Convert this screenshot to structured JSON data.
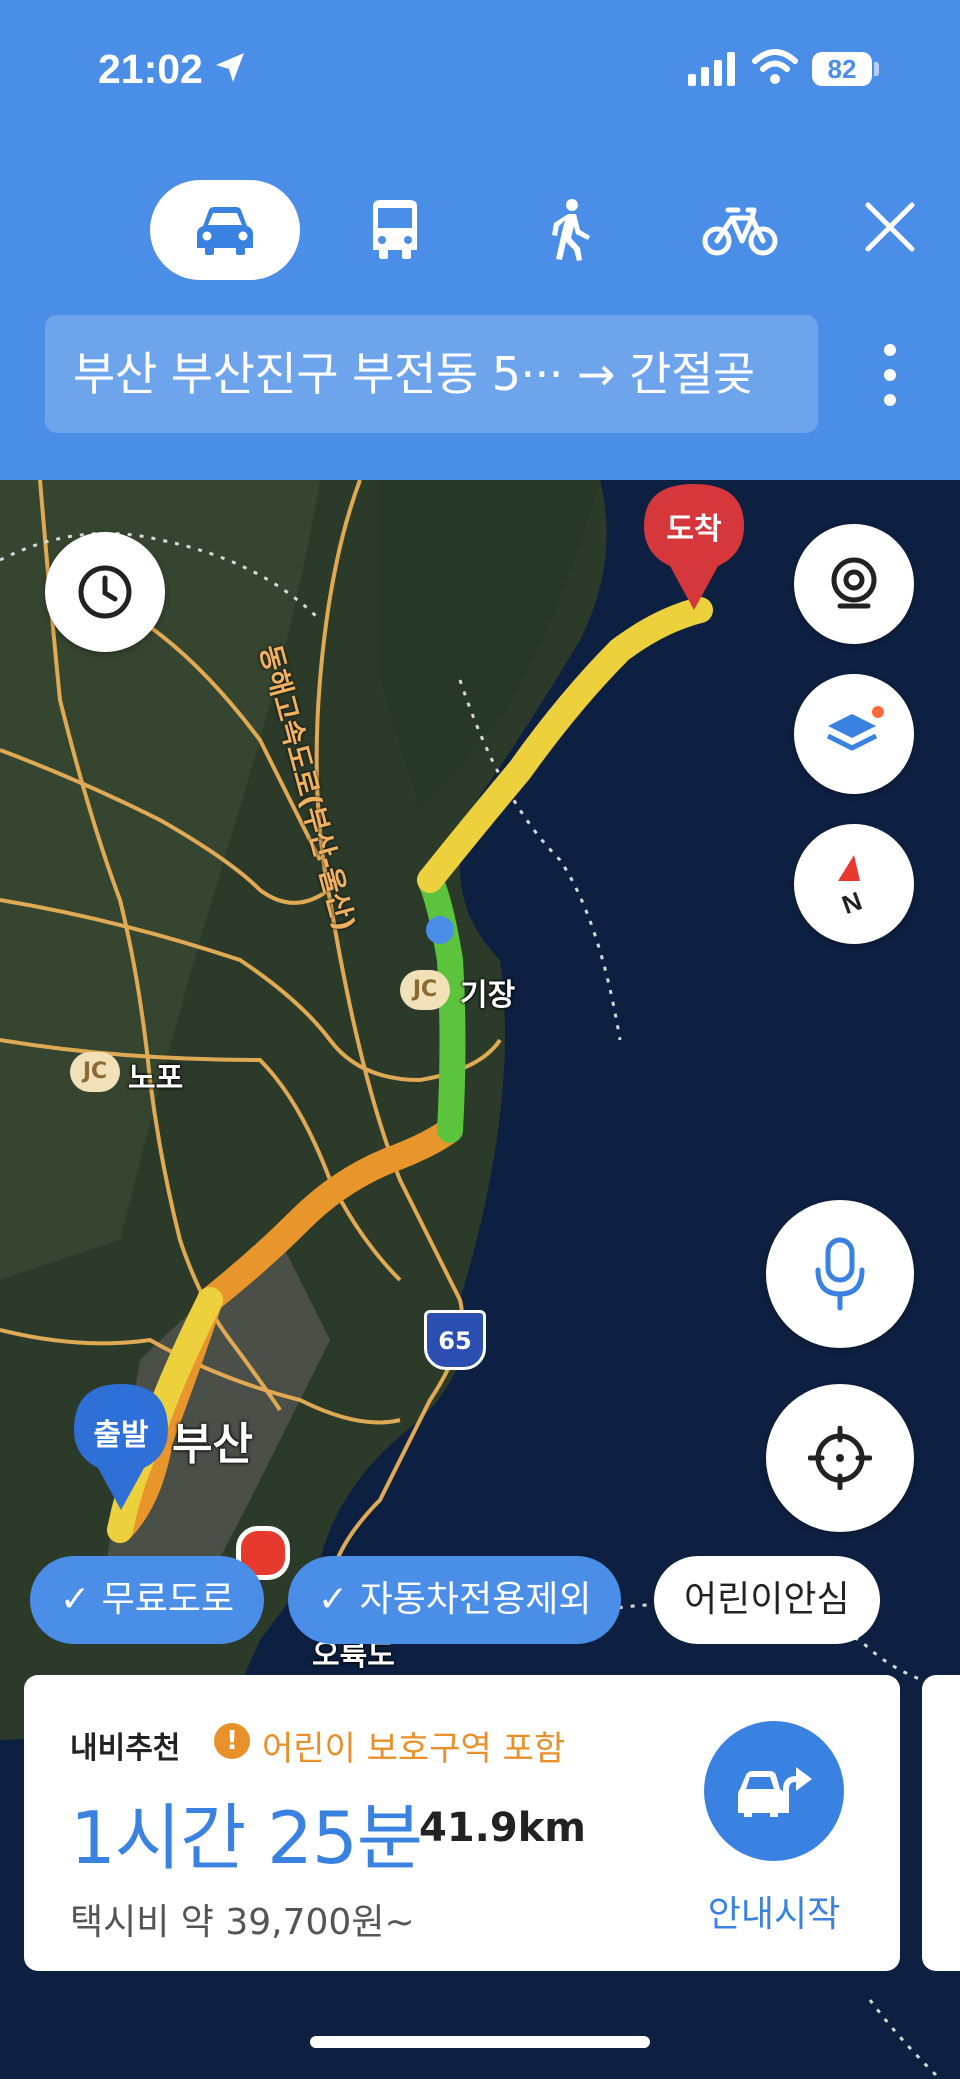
{
  "status": {
    "time": "21:02",
    "battery": "82"
  },
  "modes": {
    "car": "car-icon",
    "bus": "bus-icon",
    "walk": "walk-icon",
    "bike": "bike-icon",
    "selected": "car"
  },
  "route": {
    "text": "부산 부산진구 부전동 5··· → 간절곶"
  },
  "map": {
    "places": {
      "gijang": "기장",
      "nopo": "노포",
      "busan": "부산",
      "oryukdo": "오륙도"
    },
    "jc": "JC",
    "highway_label": "동해고속도로(부산-울산)",
    "route_shield": "65",
    "start_pin": "출발",
    "end_pin": "도착"
  },
  "chips": [
    "무료도로",
    "자동차전용제외",
    "어린이안심"
  ],
  "card": {
    "recommend": "내비추천",
    "warning": "어린이 보호구역 포함",
    "duration": "1시간 25분",
    "distance": "41.9km",
    "taxi": "택시비 약 39,700원~",
    "start": "안내시작"
  },
  "colors": {
    "accent": "#4a8ee8",
    "route_yellow": "#ecd03c",
    "route_orange": "#e8962c",
    "route_green": "#5cc33c",
    "dest_pin": "#d5373a",
    "warn": "#e8902a"
  }
}
